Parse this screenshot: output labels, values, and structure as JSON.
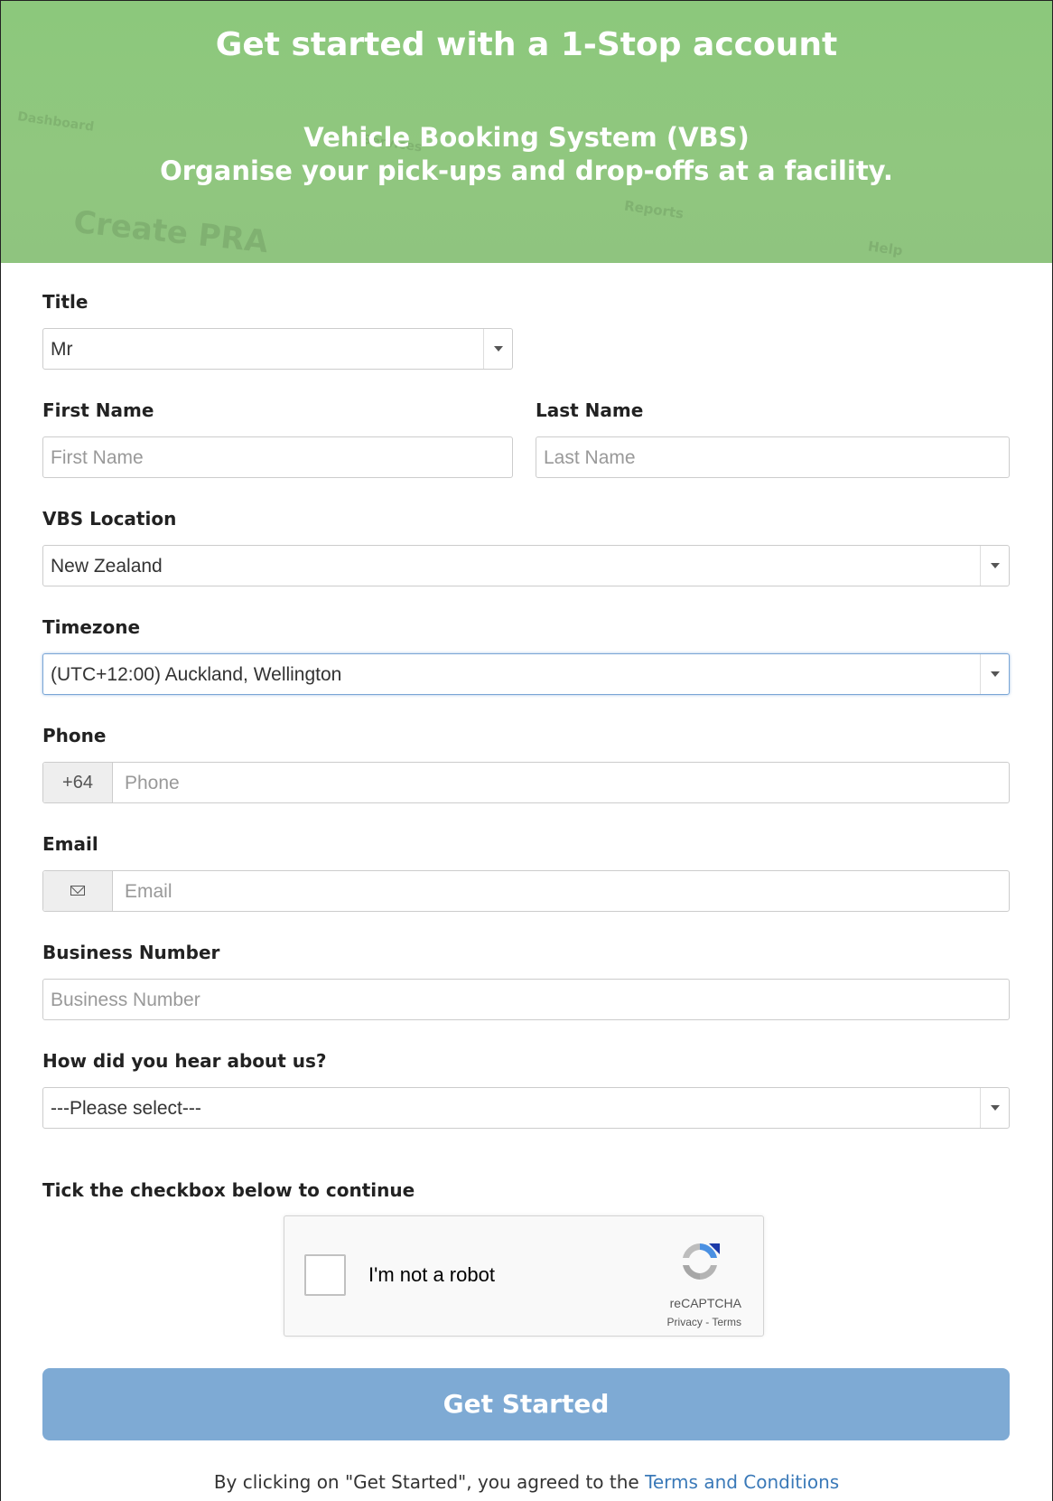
{
  "hero": {
    "title": "Get started with a 1-Stop account",
    "subtitle_line1": "Vehicle Booking System (VBS)",
    "subtitle_line2": "Organise your pick-ups and drop-offs at a facility.",
    "background_color": "#8fc77f"
  },
  "form": {
    "title": {
      "label": "Title",
      "value": "Mr"
    },
    "first_name": {
      "label": "First Name",
      "placeholder": "First Name"
    },
    "last_name": {
      "label": "Last Name",
      "placeholder": "Last Name"
    },
    "vbs_location": {
      "label": "VBS Location",
      "value": "New Zealand"
    },
    "timezone": {
      "label": "Timezone",
      "value": "(UTC+12:00) Auckland, Wellington"
    },
    "phone": {
      "label": "Phone",
      "prefix": "+64",
      "placeholder": "Phone"
    },
    "email": {
      "label": "Email",
      "icon": "envelope-icon",
      "placeholder": "Email"
    },
    "business_number": {
      "label": "Business Number",
      "placeholder": "Business Number"
    },
    "referral": {
      "label": "How did you hear about us?",
      "value": "---Please select---"
    }
  },
  "captcha": {
    "instruction": "Tick the checkbox below to continue",
    "label": "I'm not a robot",
    "brand": "reCAPTCHA",
    "links": "Privacy - Terms"
  },
  "submit": {
    "label": "Get Started",
    "color": "#7eaad4"
  },
  "terms": {
    "prefix": "By clicking on \"Get Started\", you agreed to the ",
    "link": "Terms and Conditions",
    "link_color": "#3a79b8"
  }
}
